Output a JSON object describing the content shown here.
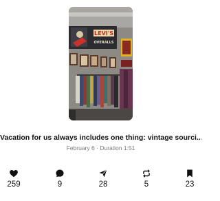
{
  "post": {
    "caption": "Vacation for us always includes one thing: vintage sourci...",
    "date": "February 6",
    "separator": "·",
    "duration": "Duration 1:51"
  },
  "stats": [
    {
      "icon": "heart-icon",
      "value": "259"
    },
    {
      "icon": "comment-icon",
      "value": "9"
    },
    {
      "icon": "share-icon",
      "value": "28"
    },
    {
      "icon": "repost-icon",
      "value": "5"
    },
    {
      "icon": "bookmark-icon",
      "value": "23"
    }
  ],
  "thumbnail": {
    "poster_text": "LEVI'S",
    "poster_sub": "OVERALLS"
  },
  "colors": {
    "text": "#111111",
    "meta": "#7a7a7a",
    "icon": "#111111"
  }
}
